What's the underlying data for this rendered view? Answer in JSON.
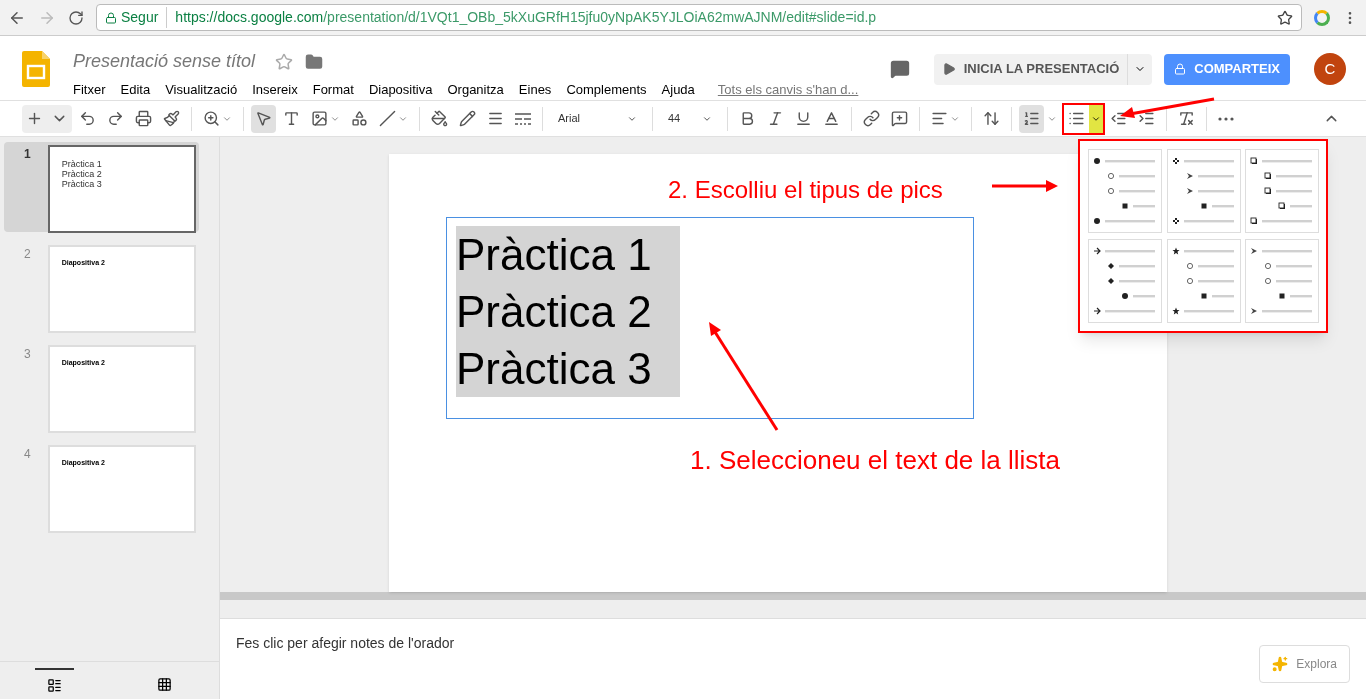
{
  "browser": {
    "secure_label": "Segur",
    "url_host": "https://docs.google.com",
    "url_path": "/presentation/d/1VQt1_OBb_5kXuGRfH15jfu0yNpAK5YJLOiA62mwAJNM/edit#slide=id.p"
  },
  "header": {
    "title": "Presentació sense títol",
    "menu": [
      "Fitxer",
      "Edita",
      "Visualització",
      "Insereix",
      "Format",
      "Diapositiva",
      "Organitza",
      "Eines",
      "Complements",
      "Ajuda"
    ],
    "save_status": "Tots els canvis s'han d...",
    "present_button": "INICIA LA PRESENTACIÓ",
    "share_button": "COMPARTEIX",
    "avatar": "C"
  },
  "toolbar": {
    "font": "Arial",
    "size": "44",
    "bulleted_list_highlighted": true
  },
  "filmstrip": [
    {
      "number": "1",
      "selected": true,
      "lines": [
        "Pràctica 1",
        "Pràctica 2",
        "Pràctica 3"
      ]
    },
    {
      "number": "2",
      "selected": false,
      "lines": [
        "Diapositiva 2"
      ]
    },
    {
      "number": "3",
      "selected": false,
      "lines": [
        "Diapositiva 2"
      ]
    },
    {
      "number": "4",
      "selected": false,
      "lines": [
        "Diapositiva 2"
      ]
    }
  ],
  "slide": {
    "lines": [
      "Pràctica 1",
      "Pràctica 2",
      "Pràctica 3"
    ],
    "text_selected": true
  },
  "bullet_menu": [
    {
      "kind": "disc"
    },
    {
      "kind": "diamond-arrow"
    },
    {
      "kind": "box"
    },
    {
      "kind": "arrow"
    },
    {
      "kind": "star"
    },
    {
      "kind": "arrowhead"
    }
  ],
  "notes": {
    "placeholder": "Fes clic per afegir notes de l'orador"
  },
  "explore_button": "Explora",
  "annotations": [
    {
      "text": "2. Escolliu el tipus de pics"
    },
    {
      "text": "1. Seleccioneu el text de la llista"
    }
  ]
}
